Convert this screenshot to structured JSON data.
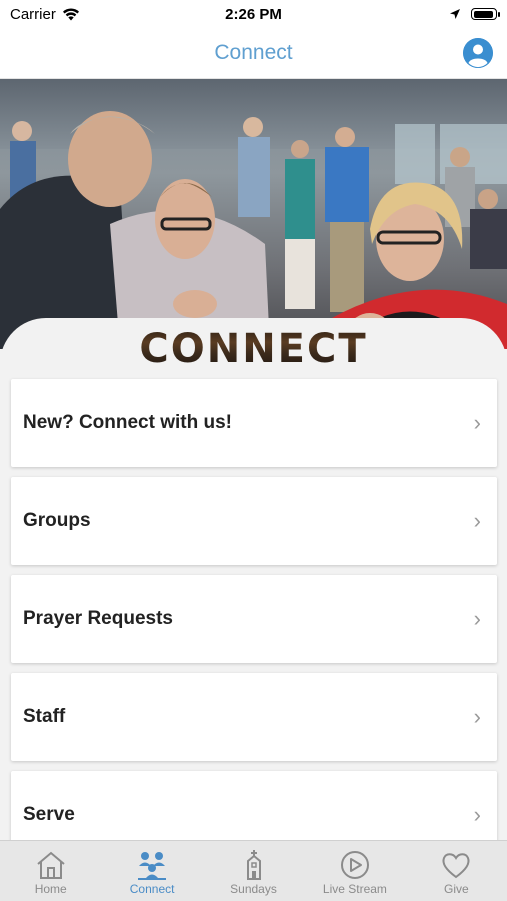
{
  "status_bar": {
    "carrier": "Carrier",
    "time": "2:26 PM",
    "battery_level": 0.95
  },
  "nav": {
    "title": "Connect",
    "profile_icon": "user-profile-icon"
  },
  "hero": {
    "image_description": ""
  },
  "logo": {
    "text": "CONNECT"
  },
  "menu": {
    "items": [
      {
        "label": "New? Connect with us!"
      },
      {
        "label": "Groups"
      },
      {
        "label": "Prayer Requests"
      },
      {
        "label": "Staff"
      },
      {
        "label": "Serve"
      }
    ]
  },
  "tabs": [
    {
      "label": "Home",
      "icon": "home-icon",
      "active": false
    },
    {
      "label": "Connect",
      "icon": "people-icon",
      "active": true
    },
    {
      "label": "Sundays",
      "icon": "church-icon",
      "active": false
    },
    {
      "label": "Live Stream",
      "icon": "play-icon",
      "active": false
    },
    {
      "label": "Give",
      "icon": "heart-icon",
      "active": false
    }
  ],
  "colors": {
    "accent": "#4a8cc6",
    "nav_title": "#5f9fd0",
    "inactive": "#8b8b8b"
  }
}
